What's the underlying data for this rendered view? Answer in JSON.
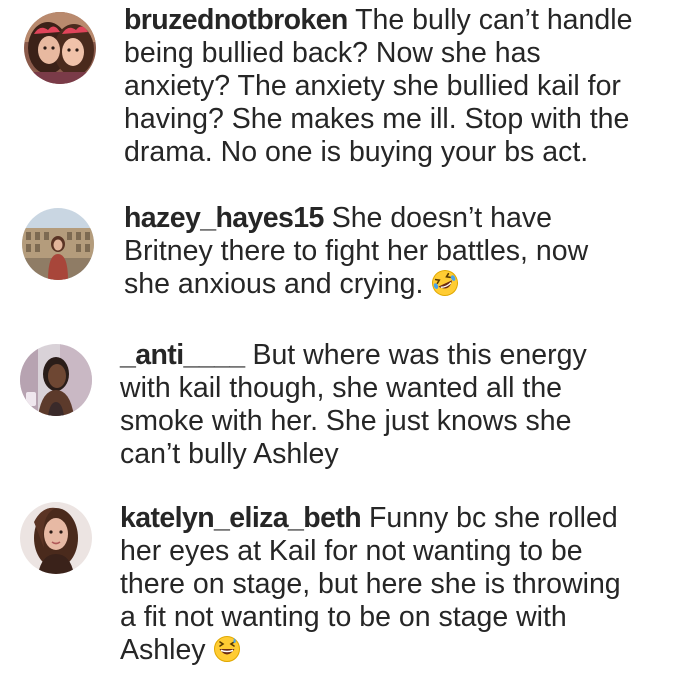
{
  "comments": [
    {
      "username": "bruzednotbroken",
      "lines": [
        " The bully can’t handle",
        "being bullied back? Now she has",
        "anxiety? The anxiety she bullied kail for",
        "having? She makes me ill. Stop with the",
        "drama. No one is buying your bs act."
      ],
      "avatar_icon": "avatar-two-girls-photo",
      "emoji": ""
    },
    {
      "username": "hazey_hayes15",
      "lines": [
        " She doesn’t have",
        "Britney there to fight her battles, now",
        "she anxious and crying."
      ],
      "avatar_icon": "avatar-colosseum-photo",
      "emoji": "rolling-on-floor-laughing-emoji"
    },
    {
      "username": "_anti____",
      "lines": [
        " But where was this energy",
        "with kail though, she wanted all the",
        "smoke with her. She just knows she",
        "can’t bully Ashley"
      ],
      "avatar_icon": "avatar-selfie-photo",
      "emoji": ""
    },
    {
      "username": "katelyn_eliza_beth",
      "lines": [
        " Funny bc she rolled",
        "her eyes at Kail for not wanting to be",
        "there on stage, but here she is throwing",
        "a fit not wanting to be on stage with",
        "Ashley"
      ],
      "avatar_icon": "avatar-portrait-photo",
      "emoji": "grinning-sweat-emoji"
    }
  ],
  "colors": {
    "text": "#262626",
    "emoji_face": "#ffcc33",
    "emoji_tear": "#4aa3e8"
  }
}
